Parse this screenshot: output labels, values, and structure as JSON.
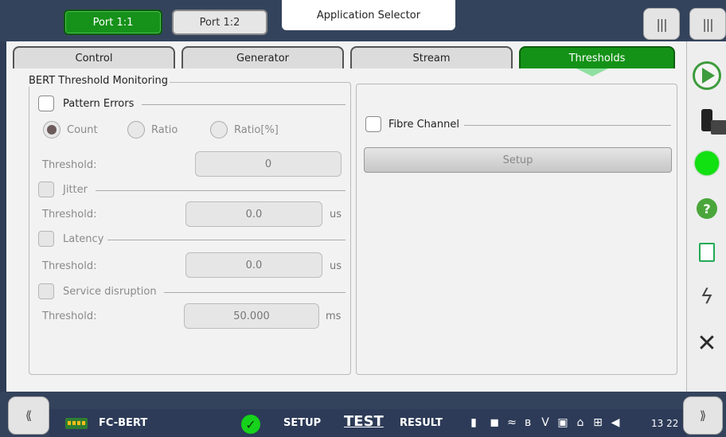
{
  "top": {
    "port_active": "Port 1:1",
    "port_inactive": "Port 1:2",
    "app_selector": "Application Selector",
    "handle_glyph": "|||"
  },
  "tabs": [
    {
      "label": "Control",
      "active": false
    },
    {
      "label": "Generator",
      "active": false
    },
    {
      "label": "Stream",
      "active": false
    },
    {
      "label": "Thresholds",
      "active": true
    }
  ],
  "bert": {
    "title": "BERT Threshold Monitoring",
    "pattern_errors": {
      "label": "Pattern Errors",
      "checked": false,
      "radios": [
        {
          "label": "Count",
          "selected": true
        },
        {
          "label": "Ratio",
          "selected": false
        },
        {
          "label": "Ratio[%]",
          "selected": false
        }
      ],
      "threshold_label": "Threshold:",
      "threshold_value": "0"
    },
    "jitter": {
      "label": "Jitter",
      "threshold_label": "Threshold:",
      "threshold_value": "0.0",
      "unit": "us"
    },
    "latency": {
      "label": "Latency",
      "threshold_label": "Threshold:",
      "threshold_value": "0.0",
      "unit": "us"
    },
    "service_disruption": {
      "label": "Service disruption",
      "threshold_label": "Threshold:",
      "threshold_value": "50.000",
      "unit": "ms"
    }
  },
  "fibre": {
    "label": "Fibre Channel",
    "checked": false,
    "setup_label": "Setup"
  },
  "sidebar": {
    "icons": [
      "play-icon",
      "traffic-light-icon",
      "status-led-icon",
      "help-icon",
      "report-icon",
      "lightning-icon",
      "close-icon"
    ],
    "help_glyph": "?",
    "bolt_glyph": "ϟ",
    "close_glyph": "✕"
  },
  "bottom": {
    "left_handle": "⟪",
    "right_handle": "⟫",
    "app_name": "FC-BERT",
    "ok_glyph": "✓",
    "setup": "SETUP",
    "test": "TEST",
    "result": "RESULT",
    "clock": "13 22"
  },
  "colors": {
    "accent_green": "#149217",
    "led_green": "#11e011",
    "frame": "#34435c"
  }
}
